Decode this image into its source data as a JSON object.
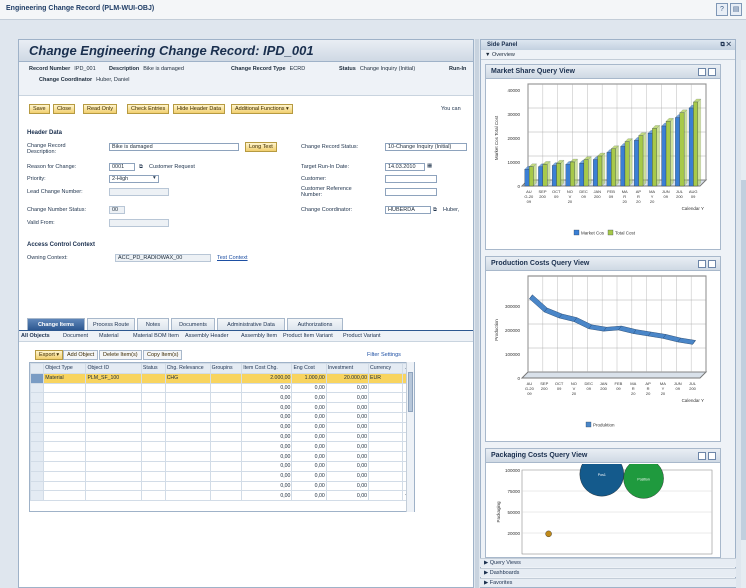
{
  "window": {
    "title": "Engineering Change Record (PLM-WUI-OBJ)"
  },
  "page": {
    "title": "Change Engineering Change Record: IPD_001"
  },
  "header_info": {
    "record_number_label": "Record Number",
    "record_number": "IPD_001",
    "description_label": "Description",
    "description": "Bike is damaged",
    "record_type_label": "Change Record Type",
    "record_type": "ECRD",
    "status_label": "Status",
    "status": "Change Inquiry (Initial)",
    "run_label": "Run-In",
    "coordinator_label": "Change Coordinator",
    "coordinator": "Huber, Daniel"
  },
  "toolbar": {
    "save": "Save",
    "close": "Close",
    "read_only": "Read Only",
    "check_entries": "Check Entries",
    "hide_header": "Hide Header Data",
    "additional": "Additional Functions ▾",
    "you_can": "You can"
  },
  "header_data": {
    "section": "Header Data",
    "change_record_desc_label": "Change Record Description:",
    "change_record_desc": "Bike is damaged",
    "long_text": "Long Text",
    "reason_label": "Reason for Change:",
    "reason_code": "0001",
    "reason_text": "Customer Request",
    "priority_label": "Priority:",
    "priority": "2-High",
    "lead_label": "Lead Change Number:",
    "cn_status_label": "Change Number Status:",
    "cn_status": "00",
    "valid_from_label": "Valid From:",
    "status_label": "Change Record Status:",
    "status": "10-Change Inquiry (Initial)",
    "target_label": "Target Run-In Date:",
    "target": "14.03.2010",
    "customer_label": "Customer:",
    "customer_ref_label": "Customer Reference Number:",
    "coord_label": "Change Coordinator:",
    "coord": "HUBERDA",
    "coord_name": "Huber,"
  },
  "access": {
    "section": "Access Control Context",
    "owning_label": "Owning Context:",
    "owning": "ACC_PD_RADIOWAX_00",
    "test_context": "Test Context"
  },
  "tabs": [
    "Change Items",
    "Process Route",
    "Notes",
    "Documents",
    "Administrative Data",
    "Authorizations"
  ],
  "subtabs": [
    "All Objects",
    "Document",
    "Material",
    "Material BOM Item",
    "Assembly Header",
    "Assembly Item",
    "Product Item Variant",
    "Product Variant"
  ],
  "table_toolbar": {
    "export": "Export ▾",
    "add": "Add Object",
    "delete": "Delete Item(s)",
    "copy": "Copy Item(s)",
    "filter": "Filter",
    "settings": "Settings"
  },
  "table": {
    "columns": [
      "Object Type",
      "Object ID",
      "Status",
      "Chg. Relevance",
      "Groupins",
      "Item Cost Chg.",
      "Eng Cost",
      "Investment",
      "Currency"
    ],
    "rows": [
      [
        "Material",
        "PLM_SF_100",
        "",
        "CHG",
        "",
        "2.000,00",
        "1.000,00",
        "20.000,00",
        "EUR"
      ],
      [
        "",
        "",
        "",
        "",
        "",
        "0,00",
        "0,00",
        "0,00",
        ""
      ],
      [
        "",
        "",
        "",
        "",
        "",
        "0,00",
        "0,00",
        "0,00",
        ""
      ],
      [
        "",
        "",
        "",
        "",
        "",
        "0,00",
        "0,00",
        "0,00",
        ""
      ],
      [
        "",
        "",
        "",
        "",
        "",
        "0,00",
        "0,00",
        "0,00",
        ""
      ],
      [
        "",
        "",
        "",
        "",
        "",
        "0,00",
        "0,00",
        "0,00",
        ""
      ],
      [
        "",
        "",
        "",
        "",
        "",
        "0,00",
        "0,00",
        "0,00",
        ""
      ],
      [
        "",
        "",
        "",
        "",
        "",
        "0,00",
        "0,00",
        "0,00",
        ""
      ],
      [
        "",
        "",
        "",
        "",
        "",
        "0,00",
        "0,00",
        "0,00",
        ""
      ],
      [
        "",
        "",
        "",
        "",
        "",
        "0,00",
        "0,00",
        "0,00",
        ""
      ],
      [
        "",
        "",
        "",
        "",
        "",
        "0,00",
        "0,00",
        "0,00",
        ""
      ],
      [
        "",
        "",
        "",
        "",
        "",
        "0,00",
        "0,00",
        "0,00",
        ""
      ],
      [
        "",
        "",
        "",
        "",
        "",
        "0,00",
        "0,00",
        "0,00",
        ""
      ]
    ]
  },
  "side_panel": {
    "title": "Side Panel",
    "overview": "▼ Overview",
    "accordion": [
      "▶ Query Views",
      "▶ Dashboards",
      "▶ Favorites"
    ]
  },
  "market_chart": {
    "title": "Market Share Query View",
    "ylabel": "Market Cos Total Cost",
    "xlabel": "Calendar Y",
    "legend": [
      "Market Cos",
      "Total Cost"
    ],
    "colors": [
      "#3b7fd4",
      "#a7c94a"
    ],
    "yticks": [
      "0",
      "10000",
      "20000",
      "30000",
      "40000"
    ],
    "categories": [
      "AU G-20 09",
      "SEP 200",
      "OCT 09",
      "NO V 20",
      "DEC 09",
      "JAN 200",
      "FEB 09",
      "MA R 20",
      "AP R 20",
      "MA Y 20",
      "JUN 09",
      "JUL 200",
      "AUG 09"
    ]
  },
  "chart_data": [
    {
      "type": "bar",
      "title": "Market Share Query View",
      "ylabel": "Market Cos Total Cost",
      "xlabel": "Calendar Y",
      "ylim": [
        0,
        40000
      ],
      "series": [
        {
          "name": "Market Cos",
          "values": [
            7000,
            8000,
            8500,
            9000,
            9500,
            11000,
            14000,
            16500,
            19000,
            22000,
            25000,
            28500,
            32500
          ]
        },
        {
          "name": "Total Cost",
          "values": [
            8000,
            9000,
            9500,
            10000,
            11000,
            12500,
            15500,
            18500,
            21000,
            24000,
            27000,
            30500,
            35000
          ]
        }
      ]
    },
    {
      "type": "line",
      "title": "Production Costs Query View",
      "ylabel": "Production",
      "xlabel": "Calendar Y",
      "ylim": [
        0,
        400000
      ],
      "series": [
        {
          "name": "Produktion",
          "values": [
            330000,
            275000,
            250000,
            235000,
            205000,
            195000,
            200000,
            185000,
            175000,
            165000,
            150000,
            140000
          ]
        }
      ]
    },
    {
      "type": "scatter",
      "title": "Packaging Costs Query View",
      "ylabel": "Packaging",
      "ylim": [
        0,
        100000
      ],
      "points": [
        {
          "x": 1,
          "y": 95000,
          "size": 22,
          "label": "Pos1"
        },
        {
          "x": 2,
          "y": 90000,
          "size": 20,
          "label": "Position"
        },
        {
          "x": 0.2,
          "y": 24000,
          "size": 3,
          "label": ""
        }
      ]
    }
  ],
  "prod_chart": {
    "title": "Production Costs Query View",
    "ylabel": "Production",
    "xlabel": "Calendar Y",
    "legend": [
      "Produktion"
    ],
    "color": "#4a86c8",
    "yticks": [
      "0",
      "100000",
      "200000",
      "300000"
    ]
  },
  "pack_chart": {
    "title": "Packaging Costs Query View",
    "ylabel": "Packaging",
    "yticks": [
      "20000",
      "50000",
      "75000",
      "100000"
    ],
    "colors": [
      "#145a8c",
      "#1f9a3e",
      "#c08a1a"
    ]
  }
}
